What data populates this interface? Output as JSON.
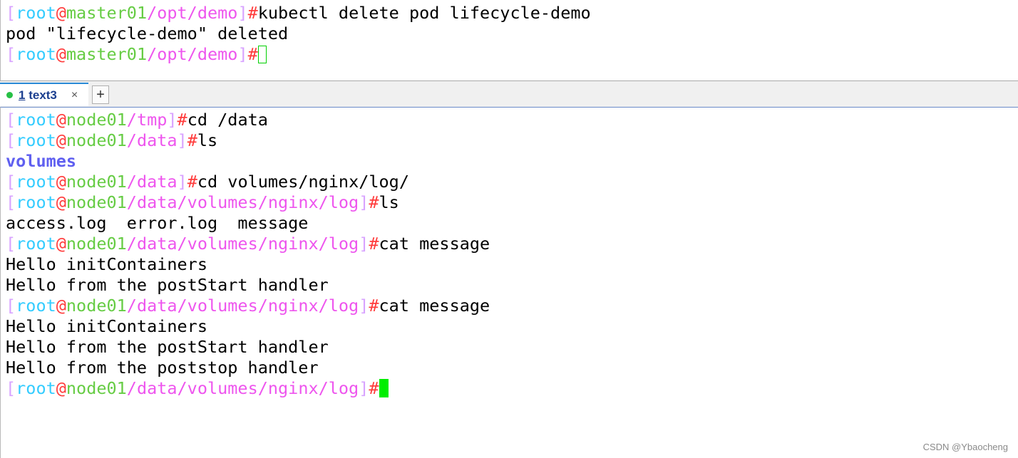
{
  "top_pane": {
    "lines": [
      {
        "type": "prompt",
        "user": "root",
        "host": "master01",
        "path": "/opt/demo",
        "cmd": "kubectl delete pod lifecycle-demo"
      },
      {
        "type": "output",
        "text": "pod \"lifecycle-demo\" deleted"
      },
      {
        "type": "prompt",
        "user": "root",
        "host": "master01",
        "path": "/opt/demo",
        "cmd": "",
        "cursor": "hollow"
      }
    ]
  },
  "tabs": [
    {
      "number": "1",
      "label": "text3",
      "close": "×",
      "status_color": "#27c046"
    }
  ],
  "new_tab_label": "+",
  "bottom_pane": {
    "lines": [
      {
        "type": "prompt",
        "user": "root",
        "host": "node01",
        "path": "/tmp",
        "cmd": "cd /data"
      },
      {
        "type": "prompt",
        "user": "root",
        "host": "node01",
        "path": "/data",
        "cmd": "ls"
      },
      {
        "type": "dir",
        "text": "volumes"
      },
      {
        "type": "prompt",
        "user": "root",
        "host": "node01",
        "path": "/data",
        "cmd": "cd volumes/nginx/log/"
      },
      {
        "type": "prompt",
        "user": "root",
        "host": "node01",
        "path": "/data/volumes/nginx/log",
        "cmd": "ls"
      },
      {
        "type": "output",
        "text": "access.log  error.log  message"
      },
      {
        "type": "prompt",
        "user": "root",
        "host": "node01",
        "path": "/data/volumes/nginx/log",
        "cmd": "cat message"
      },
      {
        "type": "output",
        "text": "Hello initContainers"
      },
      {
        "type": "output",
        "text": "Hello from the postStart handler"
      },
      {
        "type": "prompt",
        "user": "root",
        "host": "node01",
        "path": "/data/volumes/nginx/log",
        "cmd": "cat message"
      },
      {
        "type": "output",
        "text": "Hello initContainers"
      },
      {
        "type": "output",
        "text": "Hello from the postStart handler"
      },
      {
        "type": "output",
        "text": "Hello from the poststop handler"
      },
      {
        "type": "prompt",
        "user": "root",
        "host": "node01",
        "path": "/data/volumes/nginx/log",
        "cmd": "",
        "cursor": "solid"
      }
    ]
  },
  "watermark": "CSDN @Ybaocheng",
  "colors": {
    "bracket": "#d8a3ff",
    "hash": "#ff3b3b",
    "user": "#33ccff",
    "at": "#ff3b3b",
    "host": "#66cc44",
    "path": "#ee55ee",
    "dir": "#5f5ff0",
    "cursor": "#00ee00",
    "tab_accent": "#2b8ad6"
  }
}
